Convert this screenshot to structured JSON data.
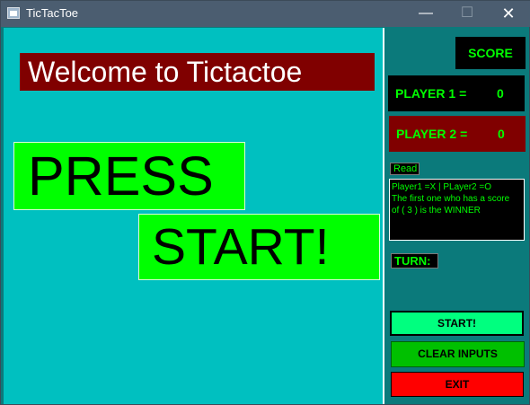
{
  "window": {
    "title": "TicTacToe",
    "minimize_glyph": "—",
    "maximize_glyph": "☐",
    "close_glyph": "✕"
  },
  "main": {
    "welcome": "Welcome to Tictactoe",
    "press": "PRESS",
    "start_big": "START!"
  },
  "scoreboard": {
    "score_label": "SCORE",
    "player1_label": "PLAYER 1  =",
    "player1_score": "0",
    "player2_label": "PLAYER 2  =",
    "player2_score": "0"
  },
  "info": {
    "read_label": "Read",
    "read_lines": [
      "Player1 =X | PLayer2 =O",
      "The first one who has a score",
      "of ( 3 ) is the WINNER"
    ],
    "turn_label": "TURN:"
  },
  "buttons": {
    "start": "START!",
    "clear": "CLEAR INPUTS",
    "exit": "EXIT"
  },
  "colors": {
    "board_bg": "#00c0c0",
    "sidebar_bg": "#0b7a7b",
    "accent_green": "#00ff00",
    "maroon": "#800000",
    "exit_red": "#ff0000"
  }
}
